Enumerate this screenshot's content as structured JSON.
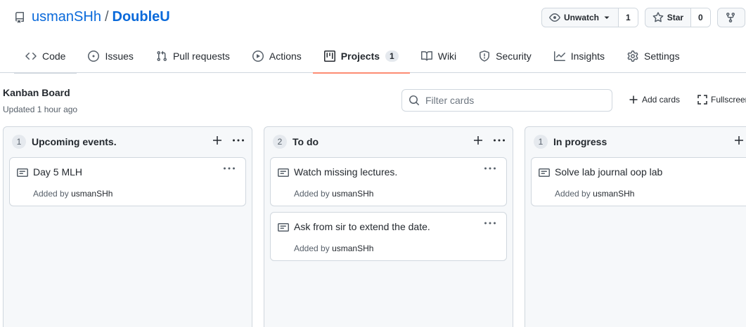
{
  "repo": {
    "owner": "usmanSHh",
    "separator": "/",
    "name": "DoubleU"
  },
  "actions": {
    "watch_label": "Unwatch",
    "watch_count": "1",
    "star_label": "Star",
    "star_count": "0"
  },
  "tabs": [
    {
      "label": "Code",
      "icon": "code-icon"
    },
    {
      "label": "Issues",
      "icon": "issue-icon"
    },
    {
      "label": "Pull requests",
      "icon": "pull-request-icon"
    },
    {
      "label": "Actions",
      "icon": "play-icon"
    },
    {
      "label": "Projects",
      "icon": "project-icon",
      "counter": "1",
      "selected": true
    },
    {
      "label": "Wiki",
      "icon": "book-icon"
    },
    {
      "label": "Security",
      "icon": "shield-icon"
    },
    {
      "label": "Insights",
      "icon": "graph-icon"
    },
    {
      "label": "Settings",
      "icon": "gear-icon"
    }
  ],
  "project": {
    "name": "Kanban Board",
    "updated": "Updated 1 hour ago",
    "filter_placeholder": "Filter cards",
    "add_cards_label": "Add cards",
    "fullscreen_label": "Fullscreen"
  },
  "columns": [
    {
      "count": "1",
      "name": "Upcoming events.",
      "cards": [
        {
          "title": "Day 5 MLH",
          "added_by_prefix": "Added by",
          "author": "usmanSHh"
        }
      ]
    },
    {
      "count": "2",
      "name": "To do",
      "cards": [
        {
          "title": "Watch missing lectures.",
          "added_by_prefix": "Added by",
          "author": "usmanSHh"
        },
        {
          "title": "Ask from sir to extend the date.",
          "added_by_prefix": "Added by",
          "author": "usmanSHh"
        }
      ]
    },
    {
      "count": "1",
      "name": "In progress",
      "cards": [
        {
          "title": "Solve lab journal oop lab",
          "added_by_prefix": "Added by",
          "author": "usmanSHh"
        }
      ]
    }
  ],
  "colors": {
    "link": "#0969da",
    "tab_underline": "#fd8c73",
    "border": "#d0d7de",
    "column_bg": "#f6f8fa",
    "muted_text": "#57606a"
  }
}
